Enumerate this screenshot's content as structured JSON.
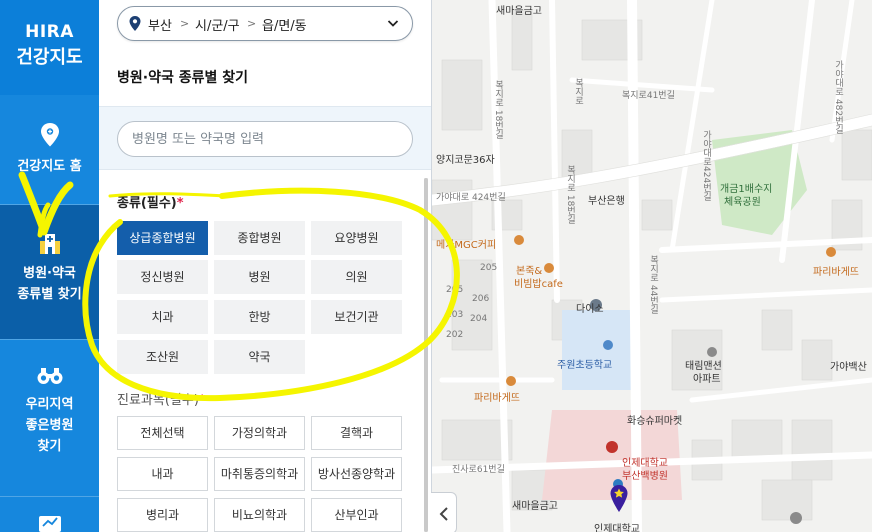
{
  "logo": {
    "line1": "HIRA",
    "line2": "건강지도"
  },
  "nav": [
    {
      "label_1": "건강지도 홈",
      "label_2": "",
      "label_3": "",
      "icon": "map-pin-icon"
    },
    {
      "label_1": "병원·약국",
      "label_2": "종류별 찾기",
      "label_3": "",
      "icon": "hospital-building-icon"
    },
    {
      "label_1": "우리지역",
      "label_2": "좋은병원",
      "label_3": "찾기",
      "icon": "binoculars-icon"
    }
  ],
  "location": {
    "city": "부산",
    "district": "시/군/구",
    "town": "읍/면/동",
    "separator": ">"
  },
  "panel_title": "병원·약국 종류별 찾기",
  "search": {
    "placeholder": "병원명 또는 약국명 입력"
  },
  "type_section": {
    "label": "종류(필수)",
    "required_mark": "*",
    "options": [
      "상급종합병원",
      "종합병원",
      "요양병원",
      "정신병원",
      "병원",
      "의원",
      "치과",
      "한방",
      "보건기관",
      "조산원",
      "약국"
    ],
    "selected": "상급종합병원"
  },
  "dept_section": {
    "label": "진료과목(필수)",
    "required_mark": "*",
    "options": [
      "전체선택",
      "가정의학과",
      "결핵과",
      "내과",
      "마취통증의학과",
      "방사선종양학과",
      "병리과",
      "비뇨의학과",
      "산부인과"
    ]
  },
  "map": {
    "labels": [
      "새마을금고",
      "복지로41번길",
      "가야대로 424번길",
      "양지코문36자",
      "부산은행",
      "개금1배수지",
      "체육공원",
      "메가MGC커피",
      "본죽&",
      "비빔밥cafe",
      "다이소",
      "파리바게뜨",
      "주원초등학교",
      "태림맨션",
      "아파트",
      "가야백산",
      "파리바게뜨",
      "화승슈퍼마켓",
      "인제대학교",
      "부산백병원",
      "진사로61번길",
      "새마을금고",
      "인제대학교"
    ],
    "road_labels": [
      "복지로 18번길",
      "복지로",
      "복지로 18번길",
      "가야대로424번길",
      "복지로 44번길",
      "가야대로 482번길"
    ],
    "building_numbers": [
      "205",
      "206",
      "205",
      "204",
      "203",
      "202"
    ],
    "colors": {
      "park": "#cfe9c6",
      "school": "#d6e6f6",
      "hospital": "#f3d7d7",
      "road": "#ffffff",
      "block": "#e6e6e4"
    }
  },
  "annotation": {
    "color": "#f5f500"
  },
  "colors": {
    "rail": "#1687dd",
    "rail_active": "#0b5fa8",
    "chip_selected": "#145eab",
    "required": "#e0234b"
  }
}
